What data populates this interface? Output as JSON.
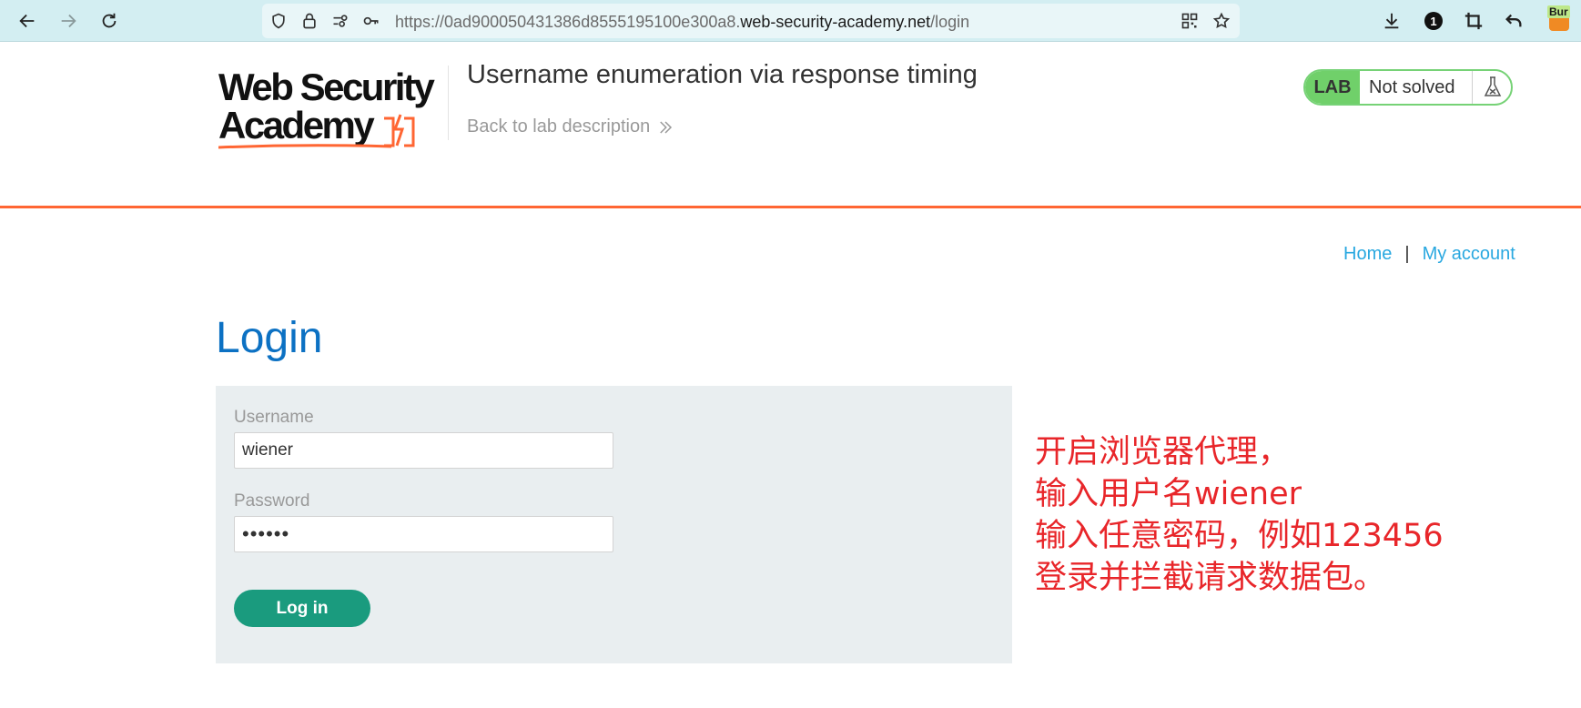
{
  "browser": {
    "url_prefix": "https://0ad900050431386d8555195100e300a8.",
    "url_domain": "web-security-academy.net",
    "url_path": "/login",
    "extension_label": "Bur",
    "downloads_badge": "1"
  },
  "header": {
    "logo_line1": "Web Security",
    "logo_line2": "Academy",
    "lab_title": "Username enumeration via response timing",
    "back_link": "Back to lab description",
    "lab_tag": "LAB",
    "lab_status": "Not solved"
  },
  "nav": {
    "home": "Home",
    "separator": "|",
    "my_account": "My account"
  },
  "login": {
    "title": "Login",
    "username_label": "Username",
    "username_value": "wiener",
    "password_label": "Password",
    "password_value": "••••••",
    "button": "Log in"
  },
  "annotation": {
    "line1": "开启浏览器代理，",
    "line2": "输入用户名wiener",
    "line3": "输入任意密码，例如123456",
    "line4": "登录并拦截请求数据包。"
  },
  "colors": {
    "accent_orange": "#ff6633",
    "title_blue": "#0c71c3",
    "link_blue": "#29a8e0",
    "button_green": "#1a9b7e",
    "annotation_red": "#e8262a"
  }
}
